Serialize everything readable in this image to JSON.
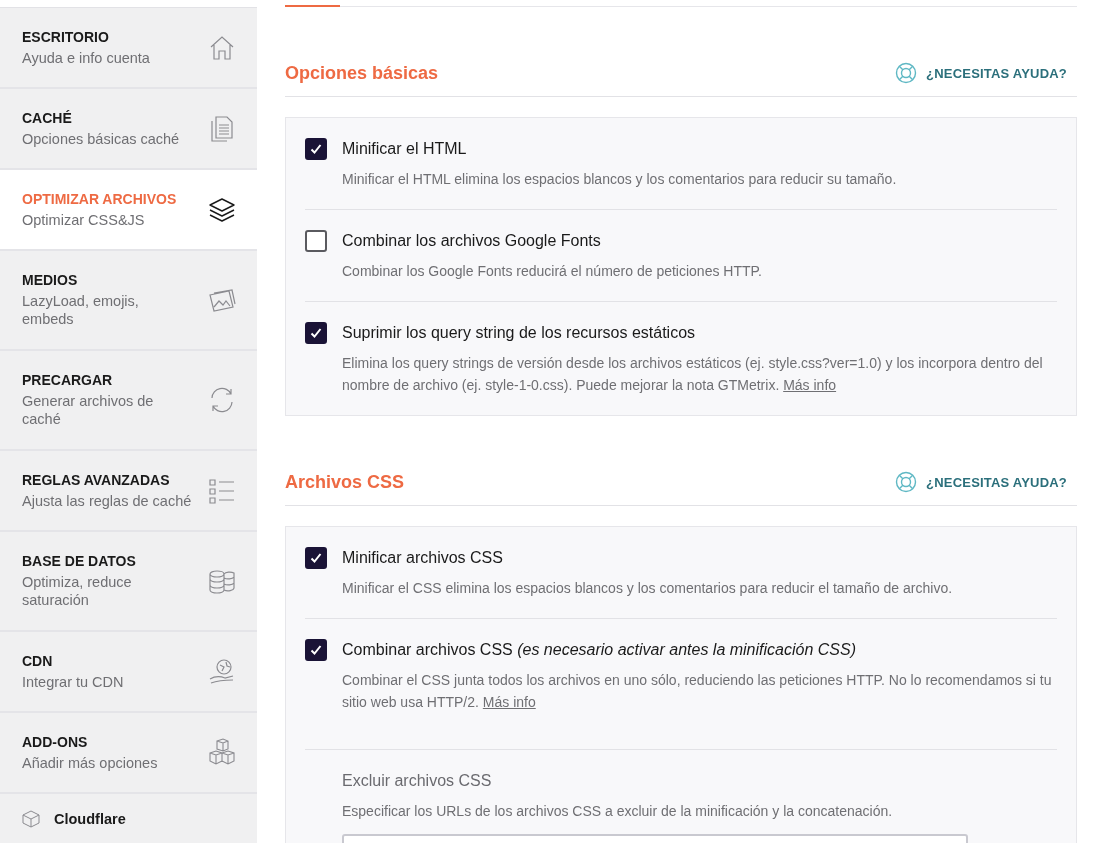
{
  "sidebar": {
    "items": [
      {
        "title": "ESCRITORIO",
        "subtitle": "Ayuda e info cuenta",
        "selected": false
      },
      {
        "title": "CACHÉ",
        "subtitle": "Opciones básicas caché",
        "selected": false
      },
      {
        "title": "OPTIMIZAR ARCHIVOS",
        "subtitle": "Optimizar CSS&JS",
        "selected": true
      },
      {
        "title": "MEDIOS",
        "subtitle": "LazyLoad, emojis, embeds",
        "selected": false
      },
      {
        "title": "PRECARGAR",
        "subtitle": "Generar archivos de caché",
        "selected": false
      },
      {
        "title": "REGLAS AVANZADAS",
        "subtitle": "Ajusta las reglas de caché",
        "selected": false
      },
      {
        "title": "BASE DE DATOS",
        "subtitle": "Optimiza, reduce saturación",
        "selected": false
      },
      {
        "title": "CDN",
        "subtitle": "Integrar tu CDN",
        "selected": false
      },
      {
        "title": "ADD-ONS",
        "subtitle": "Añadir más opciones",
        "selected": false
      }
    ],
    "addon": {
      "title": "Cloudflare"
    }
  },
  "sections": [
    {
      "title": "Opciones básicas",
      "help": "¿NECESITAS AYUDA?",
      "options": [
        {
          "kind": "checkbox",
          "checked": true,
          "label": "Minificar el HTML",
          "description": "Minificar el HTML elimina los espacios blancos y los comentarios para reducir su tamaño."
        },
        {
          "kind": "checkbox",
          "checked": false,
          "label": "Combinar los archivos Google Fonts",
          "description": "Combinar los Google Fonts reducirá el número de peticiones HTTP."
        },
        {
          "kind": "checkbox",
          "checked": true,
          "label": "Suprimir los query string de los recursos estáticos",
          "description": "Elimina los query strings de versión desde los archivos estáticos (ej. style.css?ver=1.0) y los incorpora dentro del nombre de archivo (ej. style-1-0.css). Puede mejorar la nota GTMetrix.",
          "link": "Más info"
        }
      ]
    },
    {
      "title": "Archivos CSS",
      "help": "¿NECESITAS AYUDA?",
      "options": [
        {
          "kind": "checkbox",
          "checked": true,
          "label": "Minificar archivos CSS",
          "description": "Minificar el CSS elimina los espacios blancos y los comentarios para reducir el tamaño de archivo."
        },
        {
          "kind": "checkbox",
          "checked": true,
          "label": "Combinar archivos CSS *(es necesario activar antes la minificación CSS)*",
          "description": "Combinar el CSS junta todos los archivos en uno sólo, reduciendo las peticiones HTTP. No lo recomendamos si tu sitio web usa HTTP/2.",
          "link": "Más info"
        },
        {
          "kind": "field",
          "label": "Excluir archivos CSS",
          "description": "Especificar los URLs de los archivos CSS a excluir de la minificación y la concatenación."
        }
      ]
    }
  ]
}
